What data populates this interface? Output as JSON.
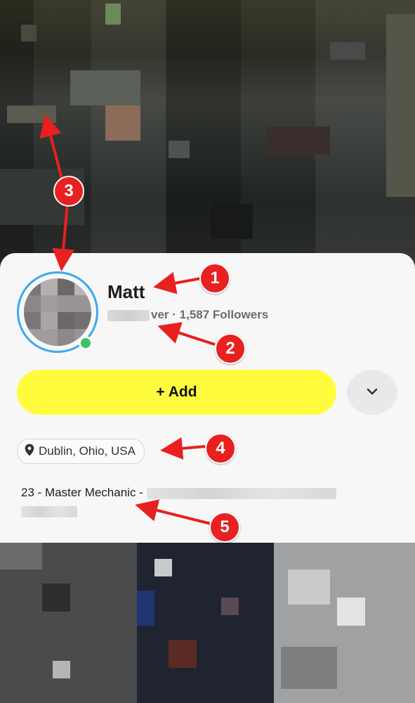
{
  "profile": {
    "name": "Matt",
    "sub_visible_tail": "ver",
    "followers": "· 1,587 Followers",
    "add_label": "+ Add",
    "location": "Dublin, Ohio, USA",
    "bio_prefix": "23 - Master Mechanic -"
  },
  "annotations": {
    "badge_1": "1",
    "badge_2": "2",
    "badge_3": "3",
    "badge_4": "4",
    "badge_5": "5"
  },
  "colors": {
    "add_button": "#fffc3e",
    "avatar_ring": "#3aa8f0",
    "online_dot": "#41c05f",
    "annotation_red": "#e8201f"
  },
  "icons": {
    "more": "chevron-down-icon",
    "location": "location-pin-icon"
  }
}
